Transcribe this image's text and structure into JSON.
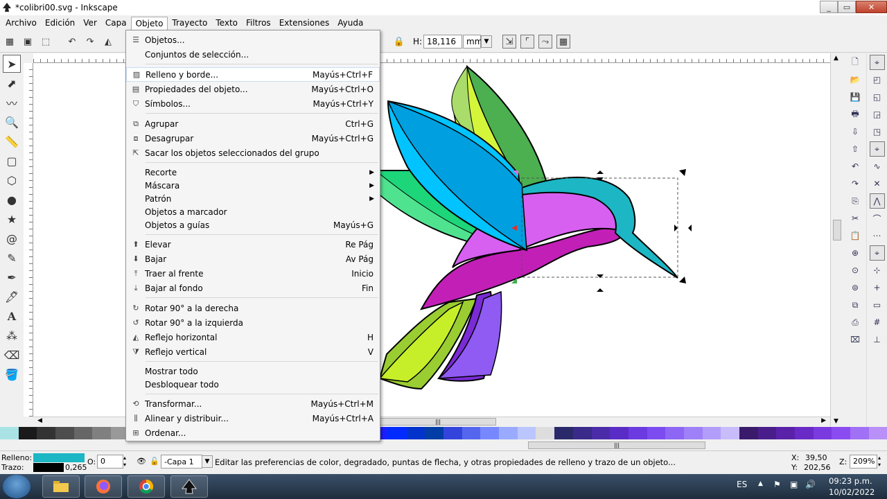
{
  "window": {
    "title": "*colibri00.svg - Inkscape"
  },
  "menubar": [
    "Archivo",
    "Edición",
    "Ver",
    "Capa",
    "Objeto",
    "Trayecto",
    "Texto",
    "Filtros",
    "Extensiones",
    "Ayuda"
  ],
  "controls": {
    "h_label": "H:",
    "h_value": "18,116",
    "unit": "mm"
  },
  "menu": {
    "items": [
      {
        "label": "Objetos...",
        "accel": "",
        "icon": "objects-icon"
      },
      {
        "label": "Conjuntos de selección...",
        "accel": "",
        "icon": ""
      },
      {
        "label": "Relleno y borde...",
        "accel": "Mayús+Ctrl+F",
        "icon": "fill-stroke-icon"
      },
      {
        "label": "Propiedades del objeto...",
        "accel": "Mayús+Ctrl+O",
        "icon": "object-properties-icon"
      },
      {
        "label": "Símbolos...",
        "accel": "Mayús+Ctrl+Y",
        "icon": "symbols-icon"
      },
      {
        "label": "Agrupar",
        "accel": "Ctrl+G",
        "icon": "group-icon"
      },
      {
        "label": "Desagrupar",
        "accel": "Mayús+Ctrl+G",
        "icon": "ungroup-icon"
      },
      {
        "label": "Sacar los objetos seleccionados del grupo",
        "accel": "",
        "icon": "pop-group-icon"
      },
      {
        "label": "Recorte",
        "accel": "",
        "icon": ""
      },
      {
        "label": "Máscara",
        "accel": "",
        "icon": ""
      },
      {
        "label": "Patrón",
        "accel": "",
        "icon": ""
      },
      {
        "label": "Objetos a marcador",
        "accel": "",
        "icon": ""
      },
      {
        "label": "Objetos a guías",
        "accel": "Mayús+G",
        "icon": ""
      },
      {
        "label": "Elevar",
        "accel": "Re Pág",
        "icon": "raise-icon"
      },
      {
        "label": "Bajar",
        "accel": "Av Pág",
        "icon": "lower-icon"
      },
      {
        "label": "Traer al frente",
        "accel": "Inicio",
        "icon": "raise-to-top-icon"
      },
      {
        "label": "Bajar al fondo",
        "accel": "Fin",
        "icon": "lower-to-bottom-icon"
      },
      {
        "label": "Rotar 90° a la derecha",
        "accel": "",
        "icon": "rotate-cw-icon"
      },
      {
        "label": "Rotar 90° a la izquierda",
        "accel": "",
        "icon": "rotate-ccw-icon"
      },
      {
        "label": "Reflejo horizontal",
        "accel": "H",
        "icon": "flip-horizontal-icon"
      },
      {
        "label": "Reflejo vertical",
        "accel": "V",
        "icon": "flip-vertical-icon"
      },
      {
        "label": "Mostrar todo",
        "accel": "",
        "icon": ""
      },
      {
        "label": "Desbloquear todo",
        "accel": "",
        "icon": ""
      },
      {
        "label": "Transformar...",
        "accel": "Mayús+Ctrl+M",
        "icon": "transform-icon"
      },
      {
        "label": "Alinear y distribuir...",
        "accel": "Mayús+Ctrl+A",
        "icon": "align-icon"
      },
      {
        "label": "Ordenar...",
        "accel": "",
        "icon": "arrange-icon"
      }
    ]
  },
  "statusbar": {
    "fill_label": "Relleno:",
    "stroke_label": "Trazo:",
    "stroke_width": "0,265",
    "opacity_label": "O:",
    "opacity_value": "0",
    "layer": "-Capa 1",
    "message": "Editar las preferencias de color, degradado, puntas de flecha, y otras propiedades de relleno y trazo de un objeto...",
    "x_label": "X:",
    "x_value": "39,50",
    "y_label": "Y:",
    "y_value": "202,56",
    "zoom_label": "Z:",
    "zoom_value": "209%"
  },
  "colors": {
    "fill": "#1db6c4",
    "stroke": "#000000",
    "accent": "#c7dcf2"
  },
  "taskbar": {
    "lang": "ES",
    "time": "09:23 p.m.",
    "date": "10/02/2022"
  }
}
